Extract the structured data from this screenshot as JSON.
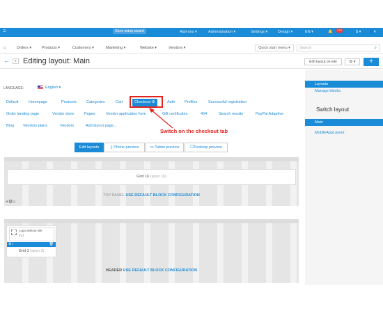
{
  "topbar": {
    "store_setup_wizard": "Store setup wizard",
    "addons": "Add-ons ▾",
    "administration": "Administration ▾",
    "settings": "Settings ▾",
    "design": "Design ▾",
    "language": "EN ▾",
    "alerts_count": "375",
    "currency": "$ ▾",
    "user": "▾"
  },
  "menu": {
    "orders": "Orders ▾",
    "products": "Products ▾",
    "customers": "Customers ▾",
    "marketing": "Marketing ▾",
    "website": "Website ▾",
    "vendors": "Vendors ▾",
    "quick_start": "Quick start menu ▾",
    "search_placeholder": "Search"
  },
  "title": {
    "text": "Editing layout: Main",
    "edit_on_site": "Edit layout on-site",
    "gear": "⚙ ▾",
    "plus": "+"
  },
  "language": {
    "label": "LANGUAGE:",
    "value": "English ▾"
  },
  "tabs_row1": [
    "Default",
    "Homepage",
    "Products",
    "Categories",
    "Cart",
    "Checkout",
    "Auth",
    "Profiles",
    "Successful registration"
  ],
  "tabs_row2": [
    "Order landing page",
    "Vendor store",
    "Pages",
    "Vendor application form",
    "Gift certificates",
    "404",
    "Search results",
    "PayPal Adaptive"
  ],
  "tabs_row3": [
    "Blog",
    "Vendors plans",
    "Vendors",
    "Add layout page..."
  ],
  "active_tab": "Checkout",
  "annotation": "Switch on the checkout tab",
  "view_buttons": {
    "edit": "Edit layouts",
    "phone": "Phone preview",
    "tablet": "Tablet preview",
    "desktop": "Desktop preview"
  },
  "top_panel": {
    "grid_label": "Grid 16",
    "grid_span": "(span 16)",
    "config_prefix": "TOP PANEL",
    "config_link": "USE DEFAULT BLOCK CONFIGURATION"
  },
  "header": {
    "logo_block": "Logo without link",
    "logo_id": "#12",
    "grid_label": "Grid 3",
    "grid_span": "(span 3)",
    "config_prefix": "HEADER",
    "config_link": "USE DEFAULT BLOCK CONFIGURATION"
  },
  "sidebar": {
    "layouts": "Layouts",
    "manage_blocks": "Manage blocks",
    "switch_layout": "Switch layout",
    "main": "Main",
    "mobile": "MobileAppLayout"
  },
  "colors": {
    "primary": "#1a8bd6",
    "annotation": "#e0251f"
  }
}
